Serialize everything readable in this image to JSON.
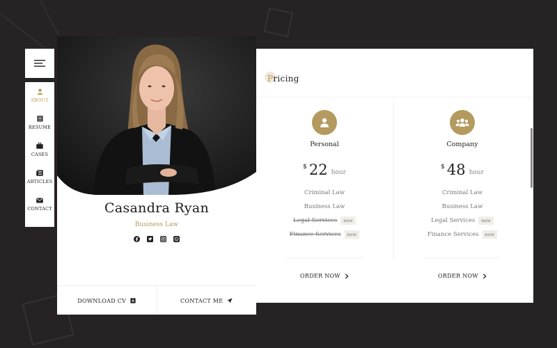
{
  "nav": {
    "menu_icon": "hamburger-menu-icon",
    "items": [
      {
        "label": "ABOUT",
        "icon": "user-icon",
        "active": true
      },
      {
        "label": "RESUME",
        "icon": "list-icon",
        "active": false
      },
      {
        "label": "CASES",
        "icon": "briefcase-icon",
        "active": false
      },
      {
        "label": "ARTICLES",
        "icon": "newspaper-icon",
        "active": false
      },
      {
        "label": "CONTACT",
        "icon": "envelope-icon",
        "active": false
      }
    ]
  },
  "profile": {
    "name": "Casandra Ryan",
    "role": "Business Law",
    "socials": [
      "facebook-icon",
      "twitter-icon",
      "instagram-icon",
      "whatsapp-icon"
    ],
    "download_label": "DOWNLOAD CV",
    "contact_label": "CONTACT ME"
  },
  "pricing": {
    "title_first": "P",
    "title_rest": "ricing",
    "plans": [
      {
        "name": "Personal",
        "icon": "person-icon",
        "currency": "$",
        "amount": "22",
        "unit": "hour",
        "features": [
          {
            "text": "Criminal Law",
            "struck": false,
            "badge": ""
          },
          {
            "text": "Business Law",
            "struck": false,
            "badge": ""
          },
          {
            "text": "Legal Services",
            "struck": true,
            "badge": "new"
          },
          {
            "text": "Finance Services",
            "struck": true,
            "badge": "new"
          }
        ],
        "order_label": "ORDER NOW"
      },
      {
        "name": "Company",
        "icon": "group-icon",
        "currency": "$",
        "amount": "48",
        "unit": "hour",
        "features": [
          {
            "text": "Criminal Law",
            "struck": false,
            "badge": ""
          },
          {
            "text": "Business Law",
            "struck": false,
            "badge": ""
          },
          {
            "text": "Legal Services",
            "struck": false,
            "badge": "new"
          },
          {
            "text": "Finance Services",
            "struck": false,
            "badge": "new"
          }
        ],
        "order_label": "ORDER NOW"
      }
    ]
  },
  "colors": {
    "background": "#272324",
    "accent": "#b49a5e",
    "card": "#ffffff"
  }
}
